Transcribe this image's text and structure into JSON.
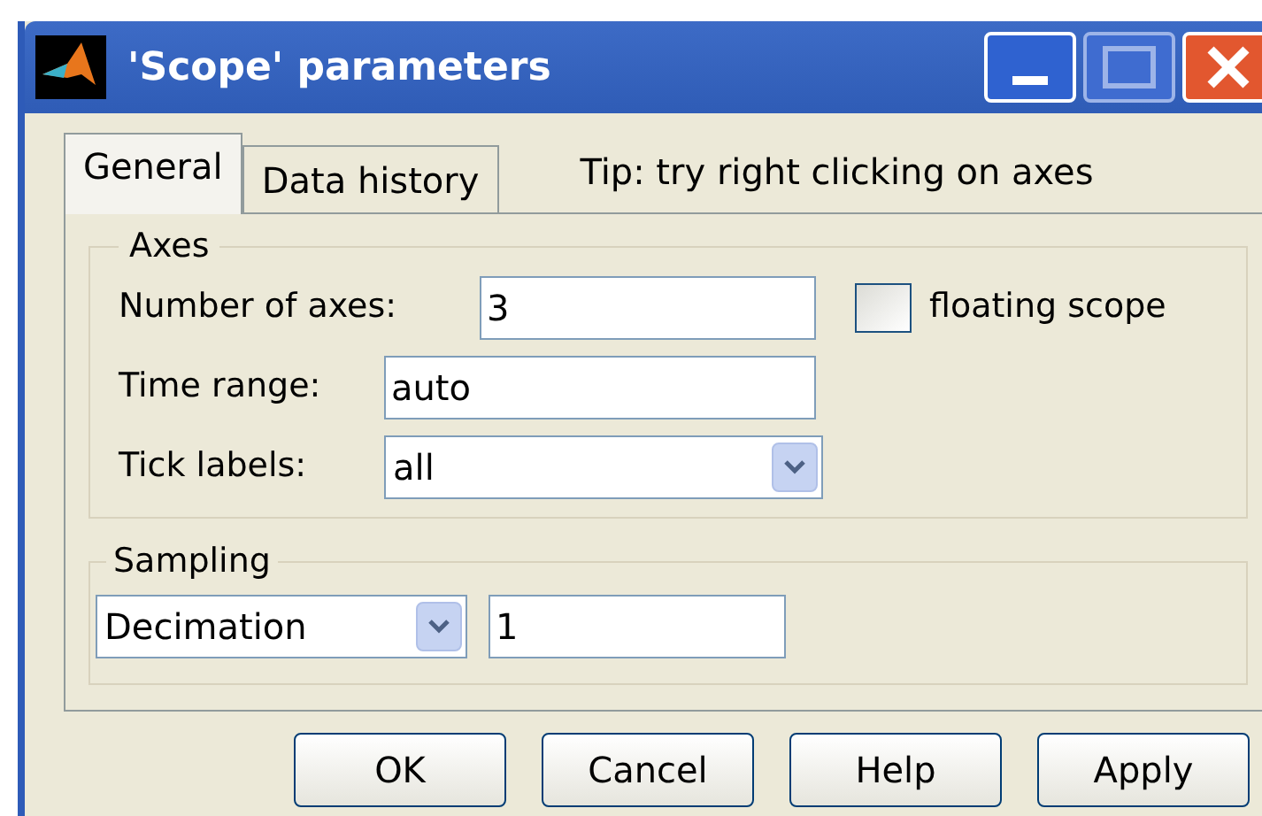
{
  "window": {
    "title": "'Scope' parameters"
  },
  "tabs": [
    {
      "label": "General",
      "selected": true
    },
    {
      "label": "Data history",
      "selected": false
    }
  ],
  "tip": "Tip: try right clicking on axes",
  "axes": {
    "legend": "Axes",
    "number_of_axes": {
      "label": "Number of axes:",
      "value": "3"
    },
    "floating_scope": {
      "label": "floating scope",
      "checked": false
    },
    "time_range": {
      "label": "Time range:",
      "value": "auto"
    },
    "tick_labels": {
      "label": "Tick labels:",
      "value": "all"
    }
  },
  "sampling": {
    "legend": "Sampling",
    "mode": "Decimation",
    "value": "1"
  },
  "buttons": [
    "OK",
    "Cancel",
    "Help",
    "Apply"
  ]
}
